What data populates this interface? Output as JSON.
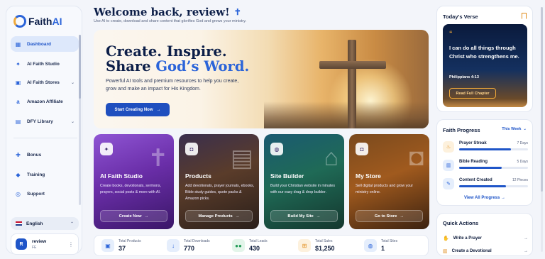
{
  "app": {
    "name_main": "Faith",
    "name_accent": "AI"
  },
  "sidebar": {
    "items": [
      {
        "label": "Dashboard",
        "icon": "grid-icon"
      },
      {
        "label": "AI Faith Studio",
        "icon": "sparkle-icon"
      },
      {
        "label": "AI Faith Stores",
        "icon": "store-icon"
      },
      {
        "label": "Amazon Affiliate",
        "icon": "amazon-icon"
      },
      {
        "label": "DFY Library",
        "icon": "library-icon"
      },
      {
        "label": "Bonus",
        "icon": "gift-icon"
      },
      {
        "label": "Training",
        "icon": "graduation-icon"
      },
      {
        "label": "Support",
        "icon": "headset-icon"
      }
    ],
    "language": "English",
    "user": {
      "initial": "R",
      "name": "review",
      "sub": "FE"
    }
  },
  "header": {
    "welcome": "Welcome back, review!",
    "cross": "✝",
    "subtitle": "Use AI to create, download and share content that glorifies God and grows your ministry."
  },
  "hero": {
    "title_line1": "Create. Inspire.",
    "title_line2_a": "Share ",
    "title_line2_b": "God’s Word.",
    "description": "Powerful AI tools and premium resources to help you create, grow and make an impact for His Kingdom.",
    "button": "Start Creating Now"
  },
  "cards": [
    {
      "title": "AI Faith Studio",
      "description": "Create books, devotionals, sermons, prayers, social posts & more with AI.",
      "button": "Create Now"
    },
    {
      "title": "Products",
      "description": "Add devotionals, prayer journals, ebooks, Bible study guides, quote packs & Amazon picks.",
      "button": "Manage Products"
    },
    {
      "title": "Site Builder",
      "description": "Build your Christian website in minutes with our easy drag & drop builder.",
      "button": "Build My Site"
    },
    {
      "title": "My Store",
      "description": "Sell digital products and grow your ministry online.",
      "button": "Go to Store"
    }
  ],
  "stats": [
    {
      "label": "Total Products",
      "value": "37",
      "icon": "box-icon",
      "color": "#2b64d9",
      "bg": "#e5eefc"
    },
    {
      "label": "Total Downloads",
      "value": "770",
      "icon": "download-icon",
      "color": "#2b64d9",
      "bg": "#e5eefc"
    },
    {
      "label": "Total Leads",
      "value": "430",
      "icon": "users-icon",
      "color": "#1f9a55",
      "bg": "#e3f5ea"
    },
    {
      "label": "Total Sales",
      "value": "$1,250",
      "icon": "cart-icon",
      "color": "#e08a16",
      "bg": "#fdf1dd"
    },
    {
      "label": "Total Sites",
      "value": "1",
      "icon": "globe-icon",
      "color": "#2b64d9",
      "bg": "#e5eefc"
    }
  ],
  "verse": {
    "title": "Today's Verse",
    "quote_mark": "“",
    "text": "I can do all things through Christ who strengthens me.",
    "reference": "Philippians 4:13",
    "button": "Read Full Chapter"
  },
  "progress": {
    "title": "Faith Progress",
    "period": "This Week",
    "items": [
      {
        "name": "Prayer Streak",
        "value": "7 Days",
        "fill": 0.75,
        "color": "#e08a16",
        "bg": "#fdf1dd"
      },
      {
        "name": "Bible Reading",
        "value": "5 Days",
        "fill": 0.62,
        "color": "#2b64d9",
        "bg": "#e5eefc"
      },
      {
        "name": "Content Created",
        "value": "12 Pieces",
        "fill": 0.68,
        "color": "#2b64d9",
        "bg": "#e5eefc"
      }
    ],
    "link": "View All Progress"
  },
  "quick_actions": {
    "title": "Quick Actions",
    "items": [
      {
        "label": "Write a Prayer",
        "icon": "hands-icon"
      },
      {
        "label": "Create a Devotional",
        "icon": "book-icon"
      }
    ]
  }
}
